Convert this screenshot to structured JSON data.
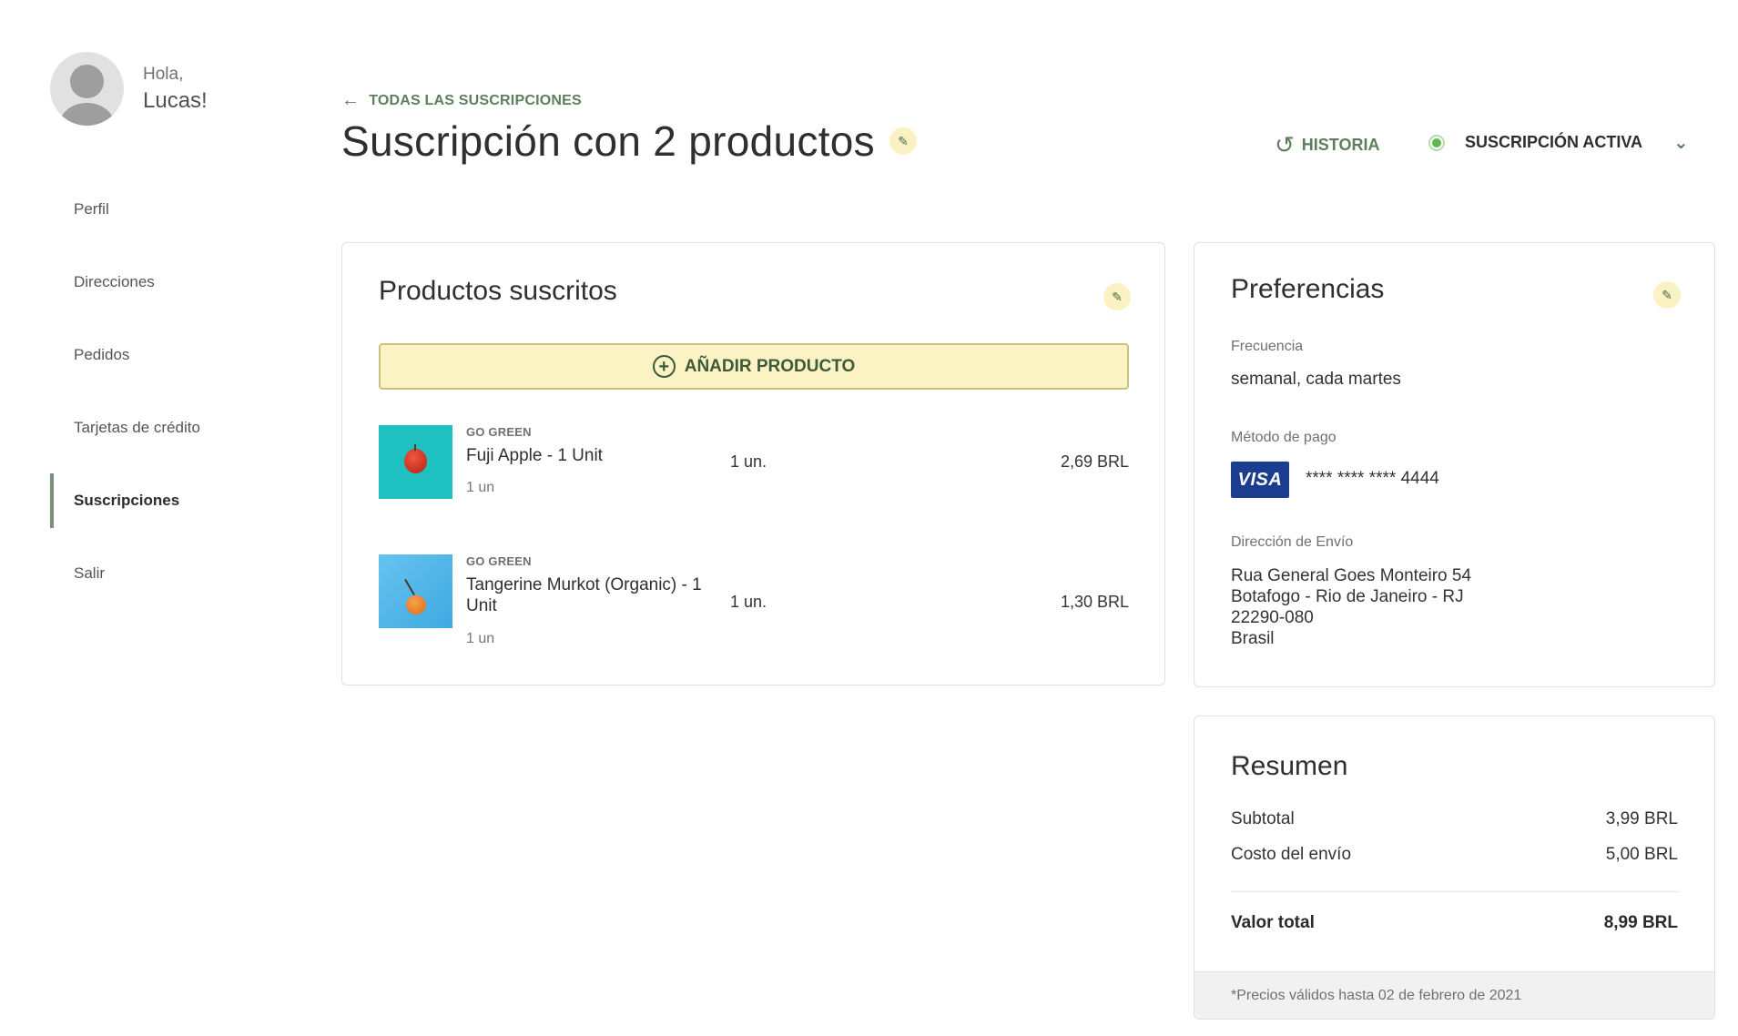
{
  "sidebar": {
    "greeting": "Hola,",
    "user_name": "Lucas!",
    "items": [
      {
        "label": "Perfil"
      },
      {
        "label": "Direcciones"
      },
      {
        "label": "Pedidos"
      },
      {
        "label": "Tarjetas de crédito"
      },
      {
        "label": "Suscripciones",
        "active": true
      },
      {
        "label": "Salir"
      }
    ]
  },
  "header": {
    "back_label": "TODAS LAS SUSCRIPCIONES",
    "title": "Suscripción con 2 productos",
    "history_label": "HISTORIA",
    "status_label": "SUSCRIPCIÓN ACTIVA"
  },
  "products": {
    "title": "Productos suscritos",
    "add_label": "AÑADIR PRODUCTO",
    "items": [
      {
        "brand": "GO GREEN",
        "name": "Fuji Apple - 1 Unit",
        "unit": "1 un",
        "qty": "1 un.",
        "price": "2,69 BRL"
      },
      {
        "brand": "GO GREEN",
        "name": "Tangerine Murkot (Organic) - 1 Unit",
        "unit": "1 un",
        "qty": "1 un.",
        "price": "1,30 BRL"
      }
    ]
  },
  "preferences": {
    "title": "Preferencias",
    "frequency_label": "Frecuencia",
    "frequency_value": "semanal, cada martes",
    "payment_label": "Método de pago",
    "card_brand": "VISA",
    "card_number": "**** **** **** 4444",
    "address_label": "Dirección de Envío",
    "address_lines": [
      "Rua General Goes Monteiro 54",
      "Botafogo - Rio de Janeiro - RJ",
      "22290-080",
      "Brasil"
    ]
  },
  "summary": {
    "title": "Resumen",
    "subtotal_label": "Subtotal",
    "subtotal_value": "3,99 BRL",
    "shipping_label": "Costo del envío",
    "shipping_value": "5,00 BRL",
    "total_label": "Valor total",
    "total_value": "8,99 BRL",
    "footnote": "*Precios válidos hasta 02 de febrero de 2021"
  },
  "colors": {
    "accent_green": "#5d7f5b",
    "button_yellow": "#fbf3c3",
    "status_green": "#5fb94f",
    "visa_blue": "#1a3d8f"
  },
  "icons": [
    "arrow-left-icon",
    "pencil-icon",
    "history-icon",
    "status-dot-icon",
    "chevron-down-icon",
    "plus-circle-icon",
    "avatar-icon"
  ]
}
